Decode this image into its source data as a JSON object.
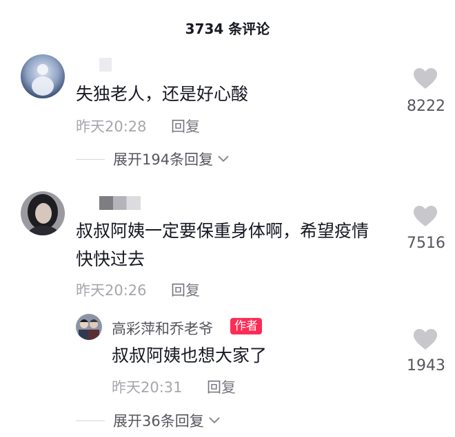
{
  "header": {
    "title": "3734 条评论"
  },
  "comments": [
    {
      "text": "失独老人，还是好心酸",
      "time": "昨天20:28",
      "reply_label": "回复",
      "likes": "8222",
      "expand_label": "展开194条回复"
    },
    {
      "text_line1": "叔叔阿姨一定要保重身体啊，希望疫情",
      "text_line2": "快快过去",
      "time": "昨天20:26",
      "reply_label": "回复",
      "likes": "7516",
      "reply": {
        "username": "高彩萍和乔老爷",
        "badge": "作者",
        "text": "叔叔阿姨也想大家了",
        "time": "昨天20:31",
        "reply_label": "回复",
        "likes": "1943"
      },
      "expand_label": "展开36条回复"
    }
  ],
  "icons": {
    "like": "heart-icon",
    "expand": "chevron-down-icon"
  },
  "colors": {
    "heart": "#c8c8cc",
    "badge": "#fe2c55"
  }
}
